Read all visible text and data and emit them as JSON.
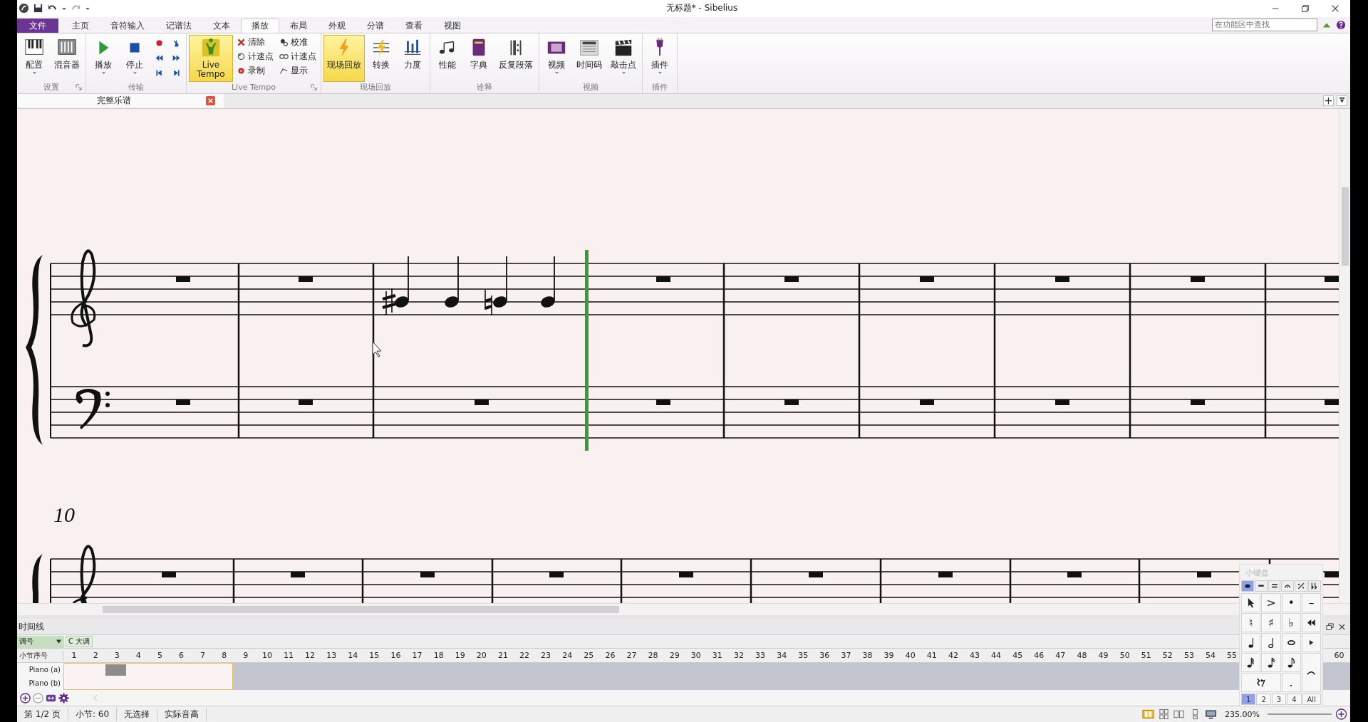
{
  "window": {
    "title": "无标题* - Sibelius"
  },
  "ribbon_tabs": [
    {
      "label": "文件",
      "kind": "file",
      "selected": false
    },
    {
      "label": "主页",
      "kind": "tab",
      "selected": false
    },
    {
      "label": "音符输入",
      "kind": "tab",
      "selected": false
    },
    {
      "label": "记谱法",
      "kind": "tab",
      "selected": false
    },
    {
      "label": "文本",
      "kind": "tab",
      "selected": false
    },
    {
      "label": "播放",
      "kind": "tab",
      "selected": true
    },
    {
      "label": "布局",
      "kind": "tab",
      "selected": false
    },
    {
      "label": "外观",
      "kind": "tab",
      "selected": false
    },
    {
      "label": "分谱",
      "kind": "tab",
      "selected": false
    },
    {
      "label": "查看",
      "kind": "tab",
      "selected": false
    },
    {
      "label": "视图",
      "kind": "tab",
      "selected": false
    }
  ],
  "ribbon_search": {
    "placeholder": "在功能区中查找"
  },
  "ribbon_groups": [
    {
      "label": "设置",
      "launcher": true,
      "buttons": [
        {
          "label": "配置",
          "kind": "large",
          "has_menu": true,
          "pressed": false
        },
        {
          "label": "混音器",
          "kind": "large",
          "has_menu": false,
          "pressed": false
        }
      ]
    },
    {
      "label": "传输",
      "launcher": false,
      "buttons": [
        {
          "label": "播放",
          "kind": "large",
          "has_menu": true,
          "pressed": false
        },
        {
          "label": "停止",
          "kind": "large",
          "has_menu": true,
          "pressed": false
        },
        {
          "kind": "icon"
        },
        {
          "kind": "icon"
        },
        {
          "kind": "icon"
        },
        {
          "kind": "icon"
        },
        {
          "kind": "icon"
        },
        {
          "kind": "icon"
        }
      ]
    },
    {
      "label": "Live Tempo",
      "launcher": true,
      "buttons": [
        {
          "label": "Live Tempo",
          "kind": "large",
          "has_menu": false,
          "pressed": true
        },
        {
          "label": "清除",
          "kind": "small"
        },
        {
          "label": "计速点",
          "kind": "small"
        },
        {
          "label": "录制",
          "kind": "small"
        },
        {
          "label": "校准",
          "kind": "small"
        },
        {
          "label": "计速点",
          "kind": "small"
        },
        {
          "label": "显示",
          "kind": "small"
        }
      ]
    },
    {
      "label": "现场回放",
      "launcher": false,
      "buttons": [
        {
          "label": "现场回放",
          "kind": "large",
          "has_menu": false,
          "pressed": true
        },
        {
          "label": "转换",
          "kind": "large",
          "has_menu": false,
          "pressed": false
        },
        {
          "label": "力度",
          "kind": "large",
          "has_menu": false,
          "pressed": false
        }
      ]
    },
    {
      "label": "诠释",
      "launcher": false,
      "buttons": [
        {
          "label": "性能",
          "kind": "large",
          "has_menu": false,
          "pressed": false
        },
        {
          "label": "字典",
          "kind": "large",
          "has_menu": false,
          "pressed": false
        },
        {
          "label": "反复段落",
          "kind": "large",
          "has_menu": false,
          "pressed": false
        }
      ]
    },
    {
      "label": "视频",
      "launcher": false,
      "buttons": [
        {
          "label": "视频",
          "kind": "large",
          "has_menu": true,
          "pressed": false
        },
        {
          "label": "时间码",
          "kind": "large",
          "has_menu": false,
          "pressed": false
        },
        {
          "label": "敲击点",
          "kind": "large",
          "has_menu": true,
          "pressed": false
        }
      ]
    },
    {
      "label": "插件",
      "launcher": false,
      "buttons": [
        {
          "label": "插件",
          "kind": "large",
          "has_menu": true,
          "pressed": false
        }
      ]
    }
  ],
  "document_tab": {
    "label": "完整乐谱"
  },
  "score": {
    "measure_number": "10"
  },
  "timeline": {
    "title": "时间线",
    "key_label": "调号",
    "key": "C 大调",
    "bar_label": "小节序号",
    "bars": [
      "1",
      "2",
      "3",
      "4",
      "5",
      "6",
      "7",
      "8",
      "9",
      "10",
      "11",
      "12",
      "13",
      "14",
      "15",
      "16",
      "17",
      "18",
      "19",
      "20",
      "21",
      "22",
      "23",
      "24",
      "25",
      "26",
      "27",
      "28",
      "29",
      "30",
      "31",
      "32",
      "33",
      "34",
      "35",
      "36",
      "37",
      "38",
      "39",
      "40",
      "41",
      "42",
      "43",
      "44",
      "45",
      "46",
      "47",
      "48",
      "49",
      "50",
      "51",
      "52",
      "53",
      "54",
      "55",
      "60"
    ],
    "instruments": [
      {
        "name": "Piano (a)"
      },
      {
        "name": "Piano (b)"
      }
    ]
  },
  "keypad": {
    "title": "小键盘",
    "tabs": [
      {
        "selected": true
      },
      {
        "selected": false
      },
      {
        "selected": false
      },
      {
        "selected": false
      },
      {
        "selected": false
      },
      {
        "selected": false
      }
    ],
    "keys": [
      {
        "kind": "icon"
      },
      {
        "kind": "glyph",
        "symbol": ">"
      },
      {
        "kind": "glyph",
        "symbol": "•"
      },
      {
        "kind": "glyph",
        "symbol": "–"
      },
      {
        "kind": "glyph",
        "symbol": "♮"
      },
      {
        "kind": "glyph",
        "symbol": "♯"
      },
      {
        "kind": "glyph",
        "symbol": "♭"
      },
      {
        "kind": "icon"
      },
      {
        "kind": "icon"
      },
      {
        "kind": "icon"
      },
      {
        "kind": "icon"
      },
      {
        "kind": "icon"
      },
      {
        "kind": "icon"
      },
      {
        "kind": "icon"
      },
      {
        "kind": "icon"
      },
      {
        "kind": "icon"
      },
      {
        "kind": "icon"
      },
      {
        "kind": "glyph",
        "symbol": "."
      }
    ],
    "layouts": [
      {
        "label": "1",
        "selected": true
      },
      {
        "label": "2",
        "selected": false
      },
      {
        "label": "3",
        "selected": false
      },
      {
        "label": "4",
        "selected": false
      },
      {
        "label": "All",
        "selected": false
      }
    ]
  },
  "status_bar": {
    "items": [
      "第 1/2 页",
      "小节: 60",
      "无选择",
      "实际音高"
    ],
    "zoom": "235.00%"
  }
}
